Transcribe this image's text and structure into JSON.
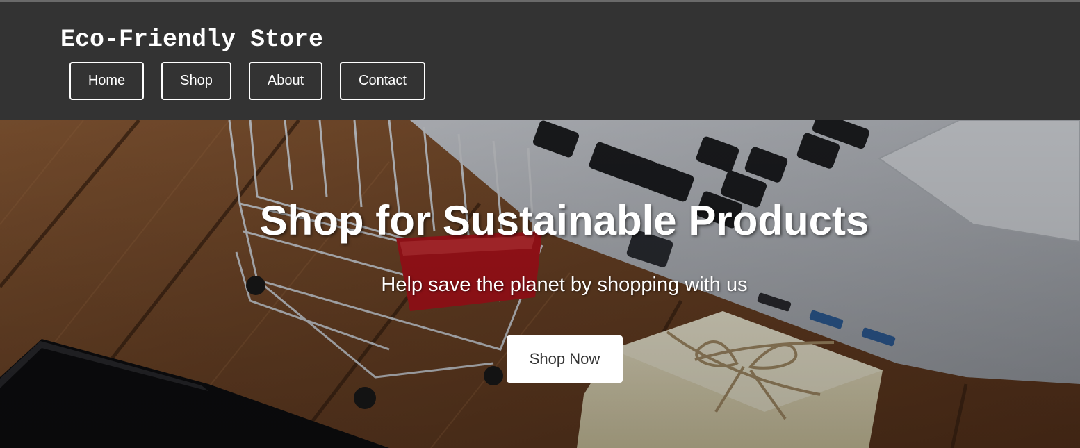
{
  "header": {
    "site_title": "Eco-Friendly Store",
    "nav": [
      {
        "label": "Home"
      },
      {
        "label": "Shop"
      },
      {
        "label": "About"
      },
      {
        "label": "Contact"
      }
    ]
  },
  "hero": {
    "title": "Shop for Sustainable Products",
    "subtitle": "Help save the planet by shopping with us",
    "cta_label": "Shop Now",
    "background_image": "shopping-cart-laptop-gift-on-wooden-table"
  },
  "colors": {
    "header_bg": "#333333",
    "text": "#ffffff",
    "cta_bg": "#ffffff",
    "cta_text": "#333333"
  }
}
